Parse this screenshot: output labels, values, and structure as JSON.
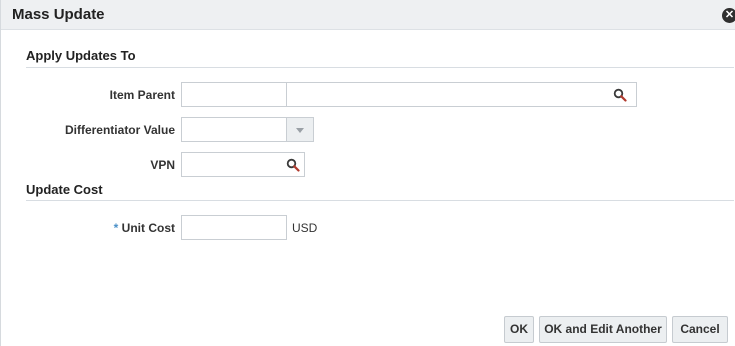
{
  "dialog": {
    "title": "Mass Update",
    "close_icon": "close-circle-icon"
  },
  "apply_updates": {
    "header": "Apply Updates To",
    "item_parent": {
      "label": "Item Parent",
      "value": "",
      "description": ""
    },
    "differentiator_value": {
      "label": "Differentiator Value",
      "value": ""
    },
    "vpn": {
      "label": "VPN",
      "value": ""
    }
  },
  "update_cost": {
    "header": "Update Cost",
    "unit_cost": {
      "required_marker": "*",
      "label": "Unit Cost",
      "value": "",
      "currency": "USD"
    }
  },
  "buttons": {
    "ok": "OK",
    "ok_edit_another": "OK and Edit Another",
    "cancel": "Cancel"
  },
  "colors": {
    "title_bar": "#eef0f2",
    "required_marker": "#4a90c8",
    "search_icon": "#3a3a3a"
  }
}
